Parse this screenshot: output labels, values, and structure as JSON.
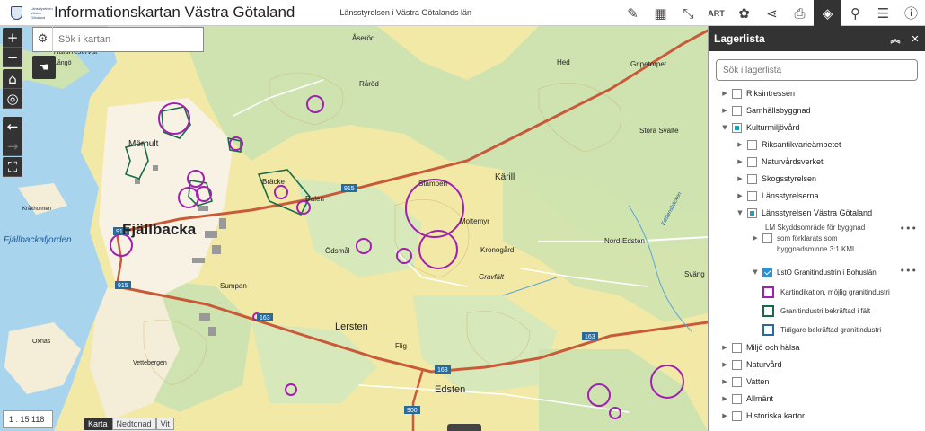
{
  "header": {
    "logo_text": "Länsstyrelsen Västra Götaland",
    "title": "Informationskartan Västra Götaland",
    "subtitle": "Länsstyrelsen i Västra Götalands län",
    "tools": [
      {
        "icon": "ruler-icon",
        "glyph": "📏"
      },
      {
        "icon": "book-icon",
        "glyph": "📖"
      },
      {
        "icon": "coordinate-icon",
        "glyph": "⤡"
      },
      {
        "icon": "art-icon",
        "label": "ART"
      },
      {
        "icon": "palette-icon",
        "glyph": "🎨"
      },
      {
        "icon": "share-icon",
        "glyph": "⋖"
      },
      {
        "icon": "print-icon",
        "glyph": "⎙"
      },
      {
        "icon": "layers-icon",
        "glyph": "◈"
      },
      {
        "icon": "search-map-icon",
        "glyph": "⌕"
      },
      {
        "icon": "list-icon",
        "glyph": "☰"
      },
      {
        "icon": "info-icon",
        "glyph": "ⓘ"
      }
    ]
  },
  "map": {
    "search_placeholder": "Sök i kartan",
    "scale": "1 : 15 118",
    "basemaps": [
      "Karta",
      "Nedtonad",
      "Vit"
    ],
    "active_basemap": "Karta",
    "places": {
      "fjallbacka": "Fjällbacka",
      "fjallbackafjorden": "Fjällbackafjorden",
      "morhult": "Mörhult",
      "aserod": "Åseröd",
      "rarod": "Råröd",
      "hed": "Hed",
      "gripetorpet": "Gripetorpet",
      "stora_svalte": "Stora Svälte",
      "brakke": "Bräcke",
      "dalen": "Dalen",
      "stampen": "Stämpen",
      "karill": "Kärill",
      "moltemyr": "Moltemyr",
      "odsmal": "Ödsmål",
      "kronogard": "Kronogård",
      "nord_edsten": "Nord-Edsten",
      "gravfalt": "Gravfält",
      "sumpan": "Sumpan",
      "lersten": "Lersten",
      "flig": "Flig",
      "edsten": "Edsten",
      "vettebergen": "Vettebergen",
      "oxnas": "Oxnäs",
      "krakholmen": "Kråkholmen",
      "langon": "Långö",
      "naturreservat": "Naturreservat",
      "svang": "Sväng",
      "edstensbacken": "Edstensbäcken"
    },
    "road_numbers": {
      "r915a": "915",
      "r915b": "915",
      "r918": "918",
      "r163a": "163",
      "r163b": "163",
      "r163c": "163",
      "r900": "900"
    }
  },
  "panel": {
    "title": "Lagerlista",
    "search_placeholder": "Sök i lagerlista",
    "layers": {
      "riksintressen": "Riksintressen",
      "samhall": "Samhällsbyggnad",
      "kultur": "Kulturmiljövård",
      "raa": "Riksantikvarieämbetet",
      "naturvard_verket": "Naturvårdsverket",
      "skog": "Skogsstyrelsen",
      "lan": "Länsstyrelserna",
      "lsvg": "Länsstyrelsen Västra Götaland",
      "lm_l1": "LM Skyddsområde för byggnad",
      "lm_l2": "som förklarats som",
      "lm_l3": "byggnadsminne 3:1 KML",
      "lsto": "LstO Granitindustrin i Bohuslän",
      "miljo": "Miljö och hälsa",
      "naturvard": "Naturvård",
      "vatten": "Vatten",
      "allmant": "Allmänt",
      "historiska": "Historiska kartor"
    },
    "legend": [
      {
        "label": "Kartindikation, möjlig granitindustri",
        "color": "#a020b0"
      },
      {
        "label": "Granitindustri bekräftad i fält",
        "color": "#1a6a4a"
      },
      {
        "label": "Tidigare bekräftad granitindustri",
        "color": "#2a6a9a"
      }
    ]
  }
}
